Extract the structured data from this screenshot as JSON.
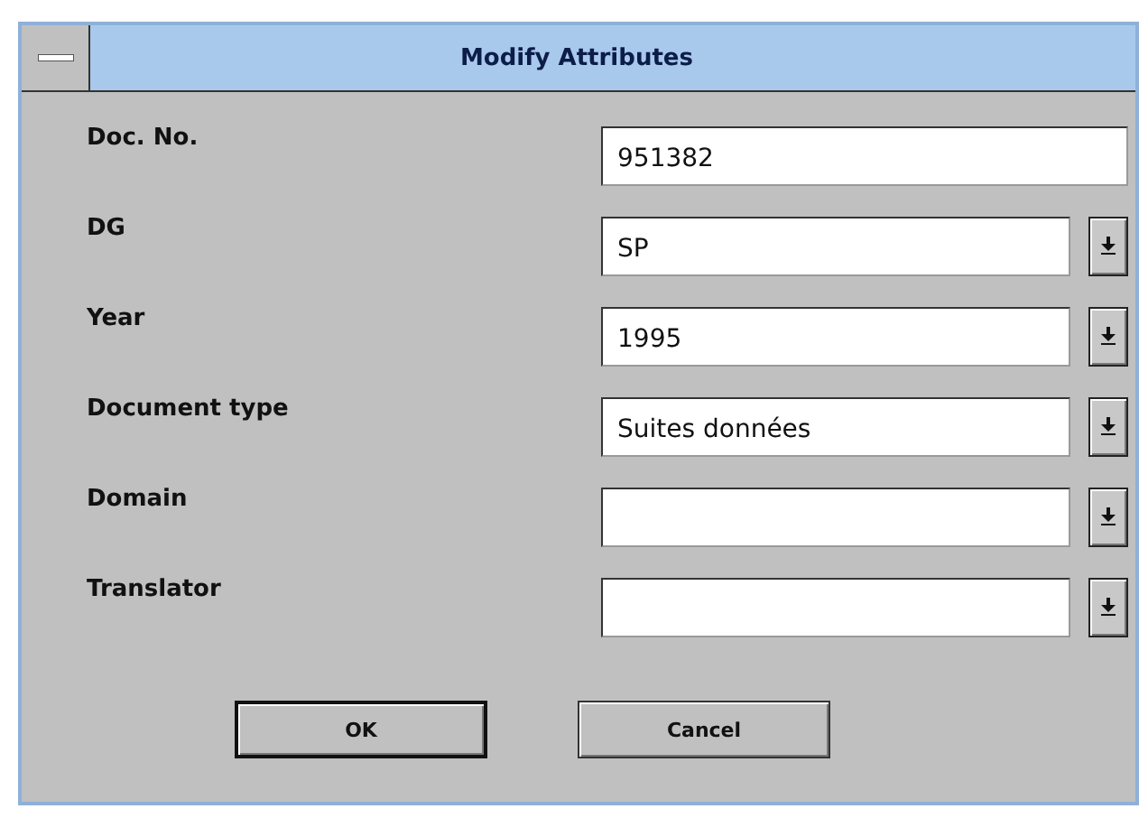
{
  "window": {
    "title": "Modify Attributes"
  },
  "fields": [
    {
      "label": "Doc. No.",
      "value": "951382",
      "kind": "text"
    },
    {
      "label": "DG",
      "value": "SP",
      "kind": "combo"
    },
    {
      "label": "Year",
      "value": "1995",
      "kind": "combo"
    },
    {
      "label": "Document type",
      "value": "Suites données",
      "kind": "combo"
    },
    {
      "label": "Domain",
      "kind": "combo"
    },
    {
      "label": "Translator",
      "kind": "combo"
    }
  ],
  "buttons": [
    {
      "label": "OK",
      "default": true
    },
    {
      "label": "Cancel",
      "default": false
    }
  ]
}
